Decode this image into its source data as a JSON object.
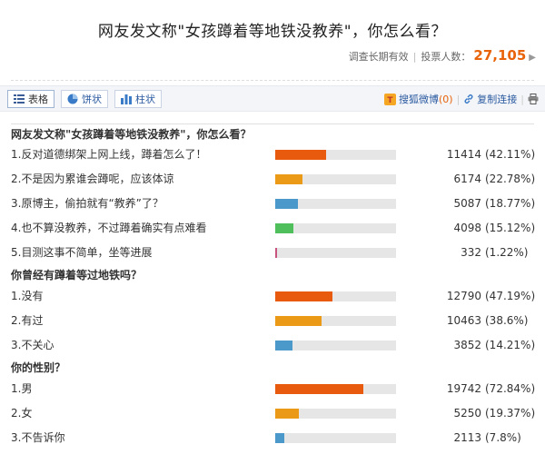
{
  "header": {
    "title": "网友发文称\"女孩蹲着等地铁没教养\"，你怎么看？"
  },
  "stats": {
    "validity": "调查长期有效",
    "voters_label": "投票人数：",
    "voters_count": "27,105"
  },
  "toolbar": {
    "tabs": [
      {
        "label": "表格",
        "icon": "table-icon",
        "active": true
      },
      {
        "label": "饼状",
        "icon": "pie-chart-icon",
        "active": false
      },
      {
        "label": "柱状",
        "icon": "bar-chart-icon",
        "active": false
      }
    ],
    "weibo_label": "搜狐微博",
    "weibo_count": "(0)",
    "copy_link_label": "复制连接"
  },
  "colors": {
    "orange_red": "#e85a0e",
    "orange": "#eb9a18",
    "blue": "#4b99cb",
    "green": "#4fbf5b",
    "pink": "#c8537e",
    "accent": "#e8630a"
  },
  "questions": [
    {
      "title": "网友发文称\"女孩蹲着等地铁没教养\"，你怎么看？",
      "options": [
        {
          "label": "1.反对道德绑架上网上线，蹲着怎么了！",
          "votes": "11414",
          "pct": "(42.11%)",
          "fraction": 0.4211,
          "color": "#e85a0e"
        },
        {
          "label": "2.不是因为累谁会蹲呢，应该体谅",
          "votes": "6174",
          "pct": "(22.78%)",
          "fraction": 0.2278,
          "color": "#eb9a18"
        },
        {
          "label": "3.原博主，偷拍就有“教养”了？",
          "votes": "5087",
          "pct": "(18.77%)",
          "fraction": 0.1877,
          "color": "#4b99cb"
        },
        {
          "label": "4.也不算没教养，不过蹲着确实有点难看",
          "votes": "4098",
          "pct": "(15.12%)",
          "fraction": 0.1512,
          "color": "#4fbf5b"
        },
        {
          "label": "5.目测这事不简单，坐等进展",
          "votes": "332",
          "pct": "(1.22%)",
          "fraction": 0.0122,
          "color": "#c8537e"
        }
      ]
    },
    {
      "title": "你曾经有蹲着等过地铁吗？",
      "options": [
        {
          "label": "1.没有",
          "votes": "12790",
          "pct": "(47.19%)",
          "fraction": 0.4719,
          "color": "#e85a0e"
        },
        {
          "label": "2.有过",
          "votes": "10463",
          "pct": "(38.6%)",
          "fraction": 0.386,
          "color": "#eb9a18"
        },
        {
          "label": "3.不关心",
          "votes": "3852",
          "pct": "(14.21%)",
          "fraction": 0.1421,
          "color": "#4b99cb"
        }
      ]
    },
    {
      "title": "你的性别？",
      "options": [
        {
          "label": "1.男",
          "votes": "19742",
          "pct": "(72.84%)",
          "fraction": 0.7284,
          "color": "#e85a0e"
        },
        {
          "label": "2.女",
          "votes": "5250",
          "pct": "(19.37%)",
          "fraction": 0.1937,
          "color": "#eb9a18"
        },
        {
          "label": "3.不告诉你",
          "votes": "2113",
          "pct": "(7.8%)",
          "fraction": 0.078,
          "color": "#4b99cb"
        }
      ]
    }
  ]
}
